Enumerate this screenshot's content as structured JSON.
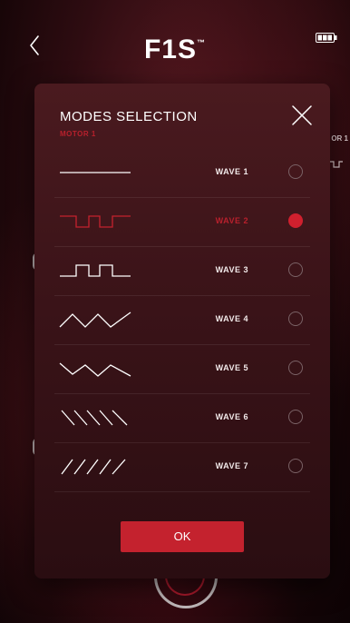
{
  "header": {
    "brand": "F1S",
    "brand_mark": "™",
    "back_icon": "chevron-left-icon",
    "battery_icon": "battery-icon"
  },
  "background": {
    "peek_label": "OR 1"
  },
  "modal": {
    "title": "MODES SELECTION",
    "subtitle": "MOTOR 1",
    "close_icon": "close-icon",
    "ok_label": "OK",
    "accent_color": "#c4222e",
    "items": [
      {
        "label": "WAVE 1",
        "wave": "flat",
        "selected": false
      },
      {
        "label": "WAVE 2",
        "wave": "pulse-low",
        "selected": true
      },
      {
        "label": "WAVE 3",
        "wave": "pulse-high",
        "selected": false
      },
      {
        "label": "WAVE 4",
        "wave": "triangle",
        "selected": false
      },
      {
        "label": "WAVE 5",
        "wave": "triangle-inverted",
        "selected": false
      },
      {
        "label": "WAVE 6",
        "wave": "sawtooth-down",
        "selected": false
      },
      {
        "label": "WAVE 7",
        "wave": "sawtooth-up",
        "selected": false
      }
    ]
  }
}
